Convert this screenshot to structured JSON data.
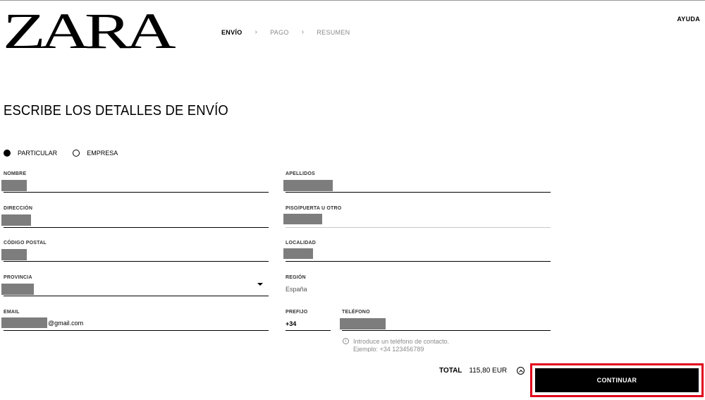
{
  "brand": {
    "logo_text": "ZARA"
  },
  "steps": [
    {
      "label": "ENVÍO",
      "state": "active"
    },
    {
      "label": "PAGO",
      "state": "inactive"
    },
    {
      "label": "RESUMEN",
      "state": "inactive"
    }
  ],
  "header": {
    "help_label": "AYUDA"
  },
  "page": {
    "title": "ESCRIBE LOS DETALLES DE ENVÍO"
  },
  "customer_type": {
    "options": [
      "PARTICULAR",
      "EMPRESA"
    ],
    "selected": "PARTICULAR"
  },
  "form": {
    "nombre": {
      "label": "NOMBRE"
    },
    "apellidos": {
      "label": "APELLIDOS"
    },
    "direccion": {
      "label": "DIRECCIÓN"
    },
    "piso": {
      "label": "PISO/PUERTA U OTRO"
    },
    "codigo_postal": {
      "label": "CÓDIGO POSTAL"
    },
    "localidad": {
      "label": "LOCALIDAD"
    },
    "provincia": {
      "label": "PROVINCIA"
    },
    "region": {
      "label": "REGIÓN",
      "value": "España"
    },
    "email": {
      "label": "EMAIL",
      "value_suffix": "@gmail.com"
    },
    "prefijo": {
      "label": "PREFIJO",
      "value": "+34"
    },
    "telefono": {
      "label": "TELÉFONO",
      "hint_line1": "Introduce un teléfono de contacto.",
      "hint_line2": "Ejemplo: +34 123456789"
    }
  },
  "summary": {
    "total_label": "TOTAL",
    "total_amount": "115,80 EUR"
  },
  "actions": {
    "continue_label": "CONTINUAR"
  },
  "colors": {
    "highlight_border": "#e0001b",
    "redaction": "#7d7d7d"
  }
}
